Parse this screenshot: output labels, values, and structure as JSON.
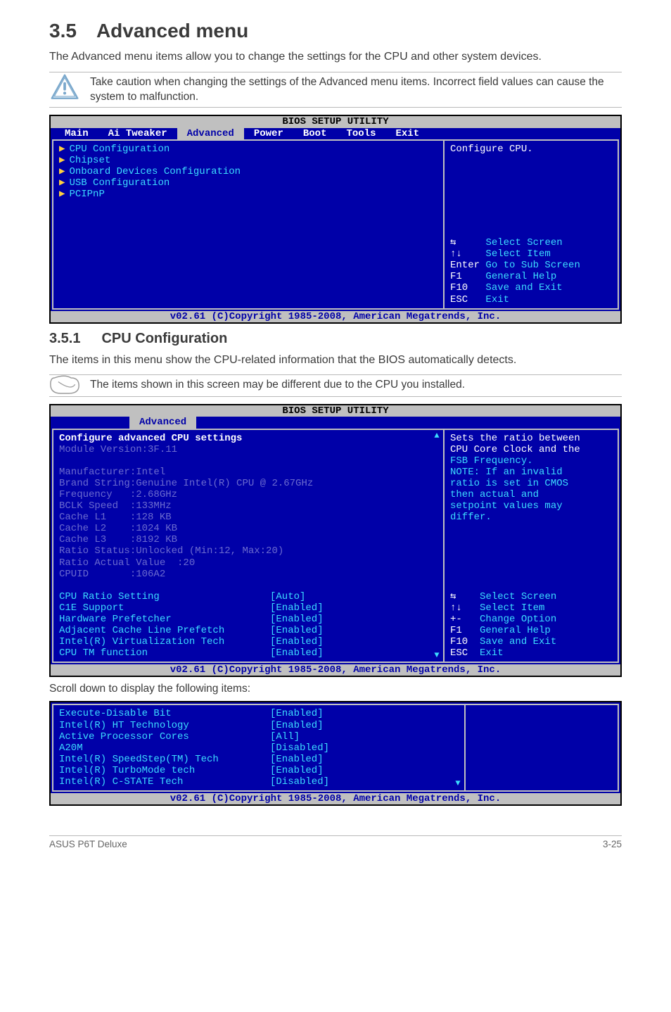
{
  "heading": {
    "num": "3.5",
    "title": "Advanced menu"
  },
  "intro": "The Advanced menu items allow you to change the settings for the CPU and other system devices.",
  "caution": "Take caution when changing the settings of the Advanced menu items. Incorrect field values can cause the system to malfunction.",
  "bios1": {
    "title": "BIOS SETUP UTILITY",
    "tabs": [
      "Main",
      "Ai Tweaker",
      "Advanced",
      "Power",
      "Boot",
      "Tools",
      "Exit"
    ],
    "selected_tab": "Advanced",
    "items": [
      "CPU Configuration",
      "Chipset",
      "Onboard Devices Configuration",
      "USB Configuration",
      "PCIPnP"
    ],
    "right_desc": "Configure CPU.",
    "keys": [
      {
        "k": "⇆",
        "t": "Select Screen"
      },
      {
        "k": "↑↓",
        "t": "Select Item"
      },
      {
        "k": "Enter",
        "t": "Go to Sub Screen"
      },
      {
        "k": "F1",
        "t": "General Help"
      },
      {
        "k": "F10",
        "t": "Save and Exit"
      },
      {
        "k": "ESC",
        "t": "Exit"
      }
    ],
    "footer": "v02.61 (C)Copyright 1985-2008, American Megatrends, Inc."
  },
  "sub": {
    "num": "3.5.1",
    "title": "CPU Configuration"
  },
  "sub_intro": "The items in this menu show the CPU-related information that the BIOS automatically detects.",
  "info_note": "The items shown in this screen may be different due to the CPU you installed.",
  "bios2": {
    "title": "BIOS SETUP UTILITY",
    "tab": "Advanced",
    "heading": "Configure advanced CPU settings",
    "info_lines": [
      "Module Version:3F.11",
      "",
      "Manufacturer:Intel",
      "Brand String:Genuine Intel(R) CPU @ 2.67GHz",
      "Frequency   :2.68GHz",
      "BCLK Speed  :133MHz",
      "Cache L1    :128 KB",
      "Cache L2    :1024 KB",
      "Cache L3    :8192 KB",
      "Ratio Status:Unlocked (Min:12, Max:20)",
      "Ratio Actual Value  :20",
      "CPUID       :106A2"
    ],
    "rows": [
      {
        "l": "CPU Ratio Setting",
        "v": "[Auto]"
      },
      {
        "l": "C1E Support",
        "v": "[Enabled]"
      },
      {
        "l": "Hardware Prefetcher",
        "v": "[Enabled]"
      },
      {
        "l": "Adjacent Cache Line Prefetch",
        "v": "[Enabled]"
      },
      {
        "l": "Intel(R) Virtualization Tech",
        "v": "[Enabled]"
      },
      {
        "l": "CPU TM function",
        "v": "[Enabled]"
      }
    ],
    "right_desc": [
      "Sets the ratio between",
      "CPU Core Clock and the",
      "FSB Frequency.",
      "NOTE: If an invalid",
      "ratio is set in CMOS",
      "then actual and",
      "setpoint values may",
      "differ."
    ],
    "keys": [
      {
        "k": "⇆",
        "t": "Select Screen"
      },
      {
        "k": "↑↓",
        "t": "Select Item"
      },
      {
        "k": "+-",
        "t": "Change Option"
      },
      {
        "k": "F1",
        "t": "General Help"
      },
      {
        "k": "F10",
        "t": "Save and Exit"
      },
      {
        "k": "ESC",
        "t": "Exit"
      }
    ],
    "footer": "v02.61 (C)Copyright 1985-2008, American Megatrends, Inc."
  },
  "scroll_text": "Scroll down to display the following items:",
  "bios3": {
    "rows": [
      {
        "l": "Execute-Disable Bit",
        "v": "[Enabled]"
      },
      {
        "l": "Intel(R) HT Technology",
        "v": "[Enabled]"
      },
      {
        "l": "Active Processor Cores",
        "v": "[All]"
      },
      {
        "l": "A20M",
        "v": "[Disabled]"
      },
      {
        "l": "Intel(R) SpeedStep(TM) Tech",
        "v": "[Enabled]"
      },
      {
        "l": "Intel(R) TurboMode tech",
        "v": "[Enabled]"
      },
      {
        "l": "Intel(R) C-STATE Tech",
        "v": "[Disabled]"
      }
    ],
    "footer": "v02.61 (C)Copyright 1985-2008, American Megatrends, Inc."
  },
  "page_footer": {
    "left": "ASUS P6T Deluxe",
    "right": "3-25"
  }
}
